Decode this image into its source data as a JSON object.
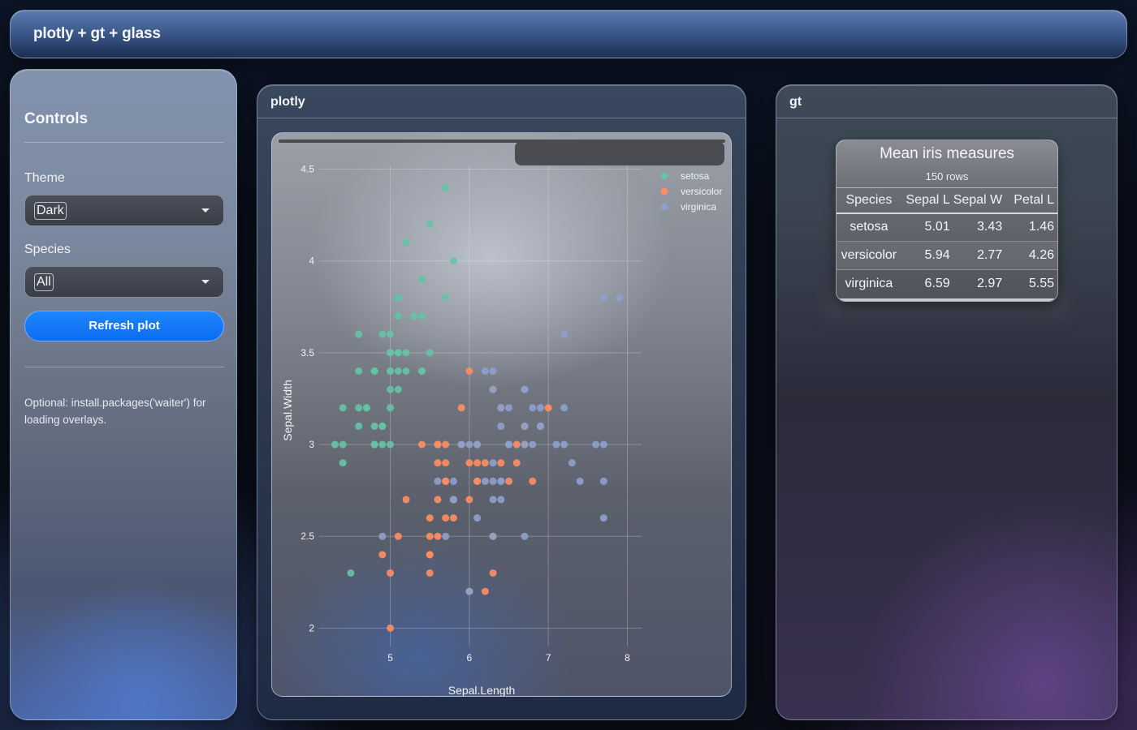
{
  "header": {
    "title": "plotly + gt + glass"
  },
  "sidebar": {
    "title": "Controls",
    "theme_label": "Theme",
    "theme_value": "Dark",
    "species_label": "Species",
    "species_value": "All",
    "refresh_label": "Refresh plot",
    "note": "Optional: install.packages('waiter') for loading overlays."
  },
  "plotly_card": {
    "title": "plotly"
  },
  "gt_card": {
    "title": "gt",
    "table": {
      "title": "Mean iris measures",
      "subtitle": "150 rows",
      "columns": [
        "Species",
        "Sepal L",
        "Sepal W",
        "Petal L"
      ],
      "rows": [
        [
          "setosa",
          "5.01",
          "3.43",
          "1.46"
        ],
        [
          "versicolor",
          "5.94",
          "2.77",
          "4.26"
        ],
        [
          "virginica",
          "6.59",
          "2.97",
          "5.55"
        ]
      ]
    }
  },
  "chart_data": {
    "type": "scatter",
    "xlabel": "Sepal.Length",
    "ylabel": "Sepal.Width",
    "xlim": [
      4.1,
      8.18
    ],
    "ylim": [
      1.9,
      4.52
    ],
    "xticks": [
      "5",
      "6",
      "7",
      "8"
    ],
    "yticks": [
      "2",
      "2.5",
      "3",
      "3.5",
      "4",
      "4.5"
    ],
    "grid": true,
    "legend_position": "top-right",
    "series": [
      {
        "name": "setosa",
        "color": "#66c2a5",
        "points": [
          [
            5.1,
            3.5
          ],
          [
            4.9,
            3.0
          ],
          [
            4.7,
            3.2
          ],
          [
            4.6,
            3.1
          ],
          [
            5.0,
            3.6
          ],
          [
            5.4,
            3.9
          ],
          [
            4.6,
            3.4
          ],
          [
            5.0,
            3.4
          ],
          [
            4.4,
            2.9
          ],
          [
            4.9,
            3.1
          ],
          [
            5.4,
            3.7
          ],
          [
            4.8,
            3.4
          ],
          [
            4.8,
            3.0
          ],
          [
            4.3,
            3.0
          ],
          [
            5.8,
            4.0
          ],
          [
            5.7,
            4.4
          ],
          [
            5.4,
            3.9
          ],
          [
            5.1,
            3.5
          ],
          [
            5.7,
            3.8
          ],
          [
            5.1,
            3.8
          ],
          [
            5.4,
            3.4
          ],
          [
            5.1,
            3.7
          ],
          [
            4.6,
            3.6
          ],
          [
            5.1,
            3.3
          ],
          [
            4.8,
            3.4
          ],
          [
            5.0,
            3.0
          ],
          [
            5.0,
            3.4
          ],
          [
            5.2,
            3.5
          ],
          [
            5.2,
            3.4
          ],
          [
            4.7,
            3.2
          ],
          [
            4.8,
            3.1
          ],
          [
            5.4,
            3.4
          ],
          [
            5.2,
            4.1
          ],
          [
            5.5,
            4.2
          ],
          [
            4.9,
            3.1
          ],
          [
            5.0,
            3.2
          ],
          [
            5.5,
            3.5
          ],
          [
            4.9,
            3.6
          ],
          [
            4.4,
            3.0
          ],
          [
            5.1,
            3.4
          ],
          [
            5.0,
            3.5
          ],
          [
            4.5,
            2.3
          ],
          [
            4.4,
            3.2
          ],
          [
            5.0,
            3.5
          ],
          [
            5.1,
            3.8
          ],
          [
            4.8,
            3.0
          ],
          [
            5.1,
            3.8
          ],
          [
            4.6,
            3.2
          ],
          [
            5.3,
            3.7
          ],
          [
            5.0,
            3.3
          ]
        ]
      },
      {
        "name": "versicolor",
        "color": "#fc8d62",
        "points": [
          [
            7.0,
            3.2
          ],
          [
            6.4,
            3.2
          ],
          [
            6.9,
            3.1
          ],
          [
            5.5,
            2.3
          ],
          [
            6.5,
            2.8
          ],
          [
            5.7,
            2.8
          ],
          [
            6.3,
            3.3
          ],
          [
            4.9,
            2.4
          ],
          [
            6.6,
            2.9
          ],
          [
            5.2,
            2.7
          ],
          [
            5.0,
            2.0
          ],
          [
            5.9,
            3.0
          ],
          [
            6.0,
            2.2
          ],
          [
            6.1,
            2.9
          ],
          [
            5.6,
            2.9
          ],
          [
            6.7,
            3.1
          ],
          [
            5.6,
            3.0
          ],
          [
            5.8,
            2.7
          ],
          [
            6.2,
            2.2
          ],
          [
            5.6,
            2.5
          ],
          [
            5.9,
            3.2
          ],
          [
            6.1,
            2.8
          ],
          [
            6.3,
            2.5
          ],
          [
            6.1,
            2.8
          ],
          [
            6.4,
            2.9
          ],
          [
            6.6,
            3.0
          ],
          [
            6.8,
            2.8
          ],
          [
            6.7,
            3.0
          ],
          [
            6.0,
            2.9
          ],
          [
            5.7,
            2.6
          ],
          [
            5.5,
            2.4
          ],
          [
            5.5,
            2.4
          ],
          [
            5.8,
            2.7
          ],
          [
            6.0,
            2.7
          ],
          [
            5.4,
            3.0
          ],
          [
            6.0,
            3.4
          ],
          [
            6.7,
            3.1
          ],
          [
            6.3,
            2.3
          ],
          [
            5.6,
            3.0
          ],
          [
            5.5,
            2.5
          ],
          [
            5.5,
            2.6
          ],
          [
            6.1,
            3.0
          ],
          [
            5.8,
            2.6
          ],
          [
            5.0,
            2.3
          ],
          [
            5.6,
            2.7
          ],
          [
            5.7,
            3.0
          ],
          [
            5.7,
            2.9
          ],
          [
            6.2,
            2.9
          ],
          [
            5.1,
            2.5
          ],
          [
            5.7,
            2.8
          ]
        ]
      },
      {
        "name": "virginica",
        "color": "#8da0cb",
        "points": [
          [
            6.3,
            3.3
          ],
          [
            5.8,
            2.7
          ],
          [
            7.1,
            3.0
          ],
          [
            6.3,
            2.9
          ],
          [
            6.5,
            3.0
          ],
          [
            7.6,
            3.0
          ],
          [
            4.9,
            2.5
          ],
          [
            7.3,
            2.9
          ],
          [
            6.7,
            2.5
          ],
          [
            7.2,
            3.6
          ],
          [
            6.5,
            3.2
          ],
          [
            6.4,
            2.7
          ],
          [
            6.8,
            3.0
          ],
          [
            5.7,
            2.5
          ],
          [
            5.8,
            2.8
          ],
          [
            6.4,
            3.2
          ],
          [
            6.5,
            3.0
          ],
          [
            7.7,
            3.8
          ],
          [
            7.7,
            2.6
          ],
          [
            6.0,
            2.2
          ],
          [
            6.9,
            3.2
          ],
          [
            5.6,
            2.8
          ],
          [
            7.7,
            2.8
          ],
          [
            6.3,
            2.7
          ],
          [
            6.7,
            3.3
          ],
          [
            7.2,
            3.2
          ],
          [
            6.2,
            2.8
          ],
          [
            6.1,
            3.0
          ],
          [
            6.4,
            2.8
          ],
          [
            7.2,
            3.0
          ],
          [
            7.4,
            2.8
          ],
          [
            7.9,
            3.8
          ],
          [
            6.4,
            2.8
          ],
          [
            6.3,
            2.8
          ],
          [
            6.1,
            2.6
          ],
          [
            7.7,
            3.0
          ],
          [
            6.3,
            3.4
          ],
          [
            6.4,
            3.1
          ],
          [
            6.0,
            3.0
          ],
          [
            6.9,
            3.1
          ],
          [
            6.7,
            3.1
          ],
          [
            6.9,
            3.1
          ],
          [
            5.8,
            2.7
          ],
          [
            6.8,
            3.2
          ],
          [
            6.7,
            3.3
          ],
          [
            6.7,
            3.0
          ],
          [
            6.3,
            2.5
          ],
          [
            6.5,
            3.0
          ],
          [
            6.2,
            3.4
          ],
          [
            5.9,
            3.0
          ]
        ]
      }
    ]
  }
}
